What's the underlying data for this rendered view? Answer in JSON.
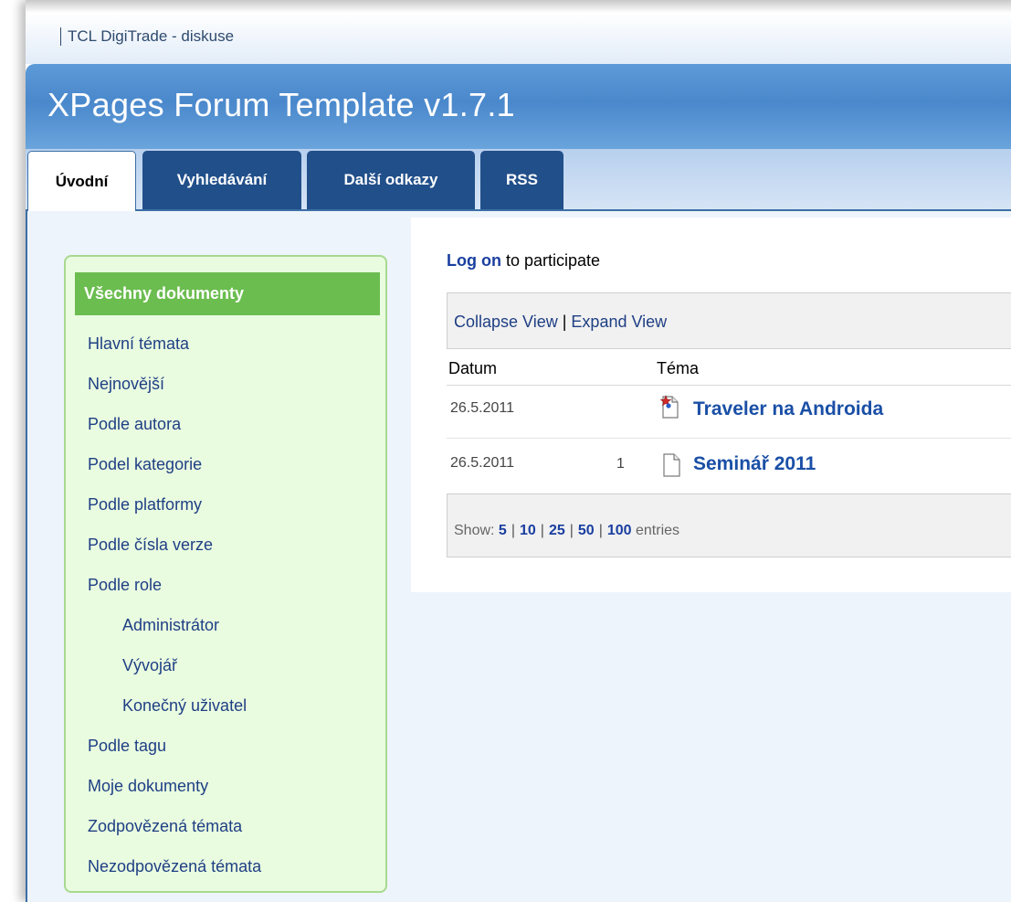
{
  "app": {
    "title": "TCL DigiTrade - diskuse"
  },
  "banner": {
    "title": "XPages Forum Template v1.7.1"
  },
  "tabs": [
    {
      "label": "Úvodní",
      "active": true
    },
    {
      "label": "Vyhledávání",
      "active": false
    },
    {
      "label": "Další odkazy",
      "active": false
    },
    {
      "label": "RSS",
      "active": false
    }
  ],
  "sidebar": {
    "header": "Všechny dokumenty",
    "items": [
      {
        "label": "Hlavní témata"
      },
      {
        "label": "Nejnovější"
      },
      {
        "label": "Podle autora"
      },
      {
        "label": "Podel kategorie"
      },
      {
        "label": "Podle platformy"
      },
      {
        "label": "Podle čísla verze"
      },
      {
        "label": "Podle role"
      },
      {
        "label": "Administrátor"
      },
      {
        "label": "Vývojář"
      },
      {
        "label": "Konečný uživatel"
      },
      {
        "label": "Podle tagu"
      },
      {
        "label": "Moje dokumenty"
      },
      {
        "label": "Zodpovězená témata"
      },
      {
        "label": "Nezodpovězená témata"
      }
    ]
  },
  "main": {
    "logon_link": "Log on",
    "logon_text": " to participate",
    "collapse_label": "Collapse View",
    "view_separator": " | ",
    "expand_label": "Expand View",
    "columns": {
      "date": "Datum",
      "topic": "Téma"
    },
    "rows": [
      {
        "date": "26.5.2011",
        "count": "",
        "title": "Traveler na Androida",
        "icon": "starred-document-icon"
      },
      {
        "date": "26.5.2011",
        "count": "1",
        "title": "Seminář 2011",
        "icon": "document-icon"
      }
    ],
    "pager": {
      "show_label": "Show:",
      "options": [
        "5",
        "10",
        "25",
        "50",
        "100"
      ],
      "separator": "|",
      "entries_label": "entries"
    }
  },
  "colors": {
    "banner": "#4a88cc",
    "tab": "#214f8a",
    "sidebar_header": "#6bbd4f",
    "sidebar_bg": "#e9fce0",
    "link": "#1a4fa6"
  }
}
